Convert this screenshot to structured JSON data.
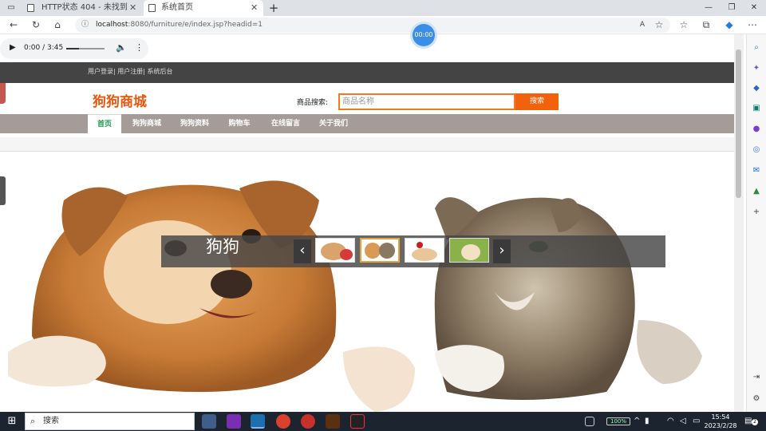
{
  "browser": {
    "tabs": [
      {
        "label": "HTTP状态 404 - 未找到",
        "active": false
      },
      {
        "label": "系统首页",
        "active": true
      }
    ],
    "url_host": "localhost",
    "url_path": ":8080/furniture/e/index.jsp?headid=1",
    "timer": "00:00"
  },
  "audio": {
    "time": "0:00 / 3:45"
  },
  "page": {
    "top_links": "用户登录| 用户注册| 系统后台",
    "logo": "狗狗商城",
    "search_label": "商品搜索:",
    "search_placeholder": "商品名称",
    "search_button": "搜索",
    "nav": [
      "首页",
      "狗狗商城",
      "狗狗资料",
      "购物车",
      "在线留言",
      "关于我们"
    ],
    "active_nav": "首页",
    "banner_caption": "狗狗",
    "prev_arrow": "‹",
    "next_arrow": "›"
  },
  "taskbar": {
    "search_placeholder": "搜索",
    "time": "15:54",
    "date": "2023/2/28",
    "battery": "100%",
    "notification_count": "2"
  },
  "colors": {
    "logo": "#e8570e",
    "search_button": "#f2610c",
    "navbar": "#a59b98",
    "topbar": "#444444",
    "active_nav_text": "#1a9a4a"
  }
}
